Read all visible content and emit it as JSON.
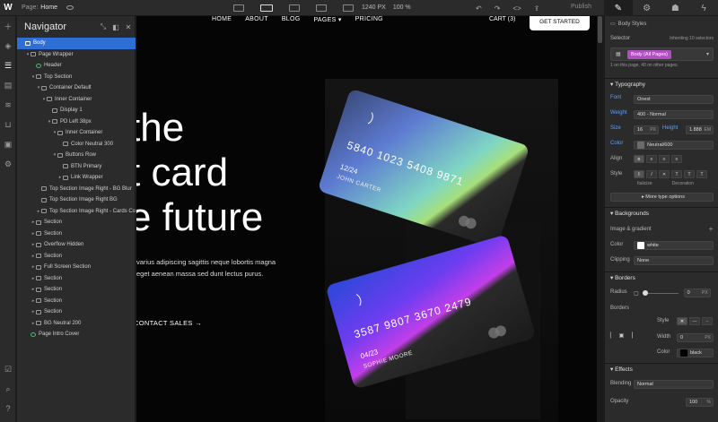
{
  "topbar": {
    "page_label": "Page:",
    "page_name": "Home",
    "width_readout": "1240 PX",
    "zoom_readout": "100 %",
    "publish_label": "Publish",
    "right_tabs": [
      "✎",
      "⚙",
      "☗",
      "ϟ"
    ]
  },
  "navigator": {
    "title": "Navigator",
    "items": [
      {
        "label": "Body",
        "depth": 0,
        "twisty": "",
        "selected": true,
        "icon": "square"
      },
      {
        "label": "Page Wrapper",
        "depth": 1,
        "twisty": "▾",
        "icon": "square"
      },
      {
        "label": "Header",
        "depth": 2,
        "twisty": "",
        "icon": "green"
      },
      {
        "label": "Top Section",
        "depth": 2,
        "twisty": "▾",
        "icon": "square"
      },
      {
        "label": "Container Default",
        "depth": 3,
        "twisty": "▾",
        "icon": "square"
      },
      {
        "label": "Inner Container",
        "depth": 4,
        "twisty": "▾",
        "icon": "square"
      },
      {
        "label": "Display 1",
        "depth": 5,
        "twisty": "",
        "icon": "text"
      },
      {
        "label": "PD Left 38px",
        "depth": 5,
        "twisty": "▾",
        "icon": "square"
      },
      {
        "label": "Inner Container",
        "depth": 6,
        "twisty": "▾",
        "icon": "square"
      },
      {
        "label": "Color Neutral 300",
        "depth": 7,
        "twisty": "",
        "icon": "text"
      },
      {
        "label": "Buttons Row",
        "depth": 6,
        "twisty": "▾",
        "icon": "square"
      },
      {
        "label": "BTN Primary",
        "depth": 7,
        "twisty": "",
        "icon": "link"
      },
      {
        "label": "Link Wrapper",
        "depth": 7,
        "twisty": "▸",
        "icon": "link"
      },
      {
        "label": "Top Section Image Right - BG Blur",
        "depth": 3,
        "twisty": "",
        "icon": "square"
      },
      {
        "label": "Top Section Image Right BG",
        "depth": 3,
        "twisty": "",
        "icon": "image"
      },
      {
        "label": "Top Section Image Right - Cards Co",
        "depth": 3,
        "twisty": "▸",
        "icon": "square"
      },
      {
        "label": "Section",
        "depth": 2,
        "twisty": "▸",
        "icon": "square"
      },
      {
        "label": "Section",
        "depth": 2,
        "twisty": "▸",
        "icon": "square"
      },
      {
        "label": "Overflow Hidden",
        "depth": 2,
        "twisty": "▸",
        "icon": "square"
      },
      {
        "label": "Section",
        "depth": 2,
        "twisty": "▸",
        "icon": "square"
      },
      {
        "label": "Full Screen Section",
        "depth": 2,
        "twisty": "▸",
        "icon": "square"
      },
      {
        "label": "Section",
        "depth": 2,
        "twisty": "▸",
        "icon": "square"
      },
      {
        "label": "Section",
        "depth": 2,
        "twisty": "▸",
        "icon": "square"
      },
      {
        "label": "Section",
        "depth": 2,
        "twisty": "▸",
        "icon": "square"
      },
      {
        "label": "Section",
        "depth": 2,
        "twisty": "▸",
        "icon": "square"
      },
      {
        "label": "BG Neutral 200",
        "depth": 2,
        "twisty": "▸",
        "icon": "square"
      },
      {
        "label": "Page Intro Cover",
        "depth": 1,
        "twisty": "",
        "icon": "green"
      }
    ]
  },
  "canvas": {
    "nav_links": [
      "HOME",
      "ABOUT",
      "BLOG",
      "PAGES ▾",
      "PRICING"
    ],
    "cart": "CART (3)",
    "cta": "GET STARTED",
    "hero_lines": [
      "the",
      "t card",
      "e future"
    ],
    "paragraph": "varius adipiscing sagittis neque lobortis magna eget aenean massa sed dunt lectus purus.",
    "secondary_cta": "CONTACT SALES →",
    "card1": {
      "number": "5840 1023 5408 9871",
      "expiry": "12/24",
      "name": "JOHN CARTER"
    },
    "card2": {
      "number": "3587 9807 3670 2479",
      "expiry": "04/23",
      "name": "SOPHIE MOORE"
    }
  },
  "panel": {
    "header": "Body Styles",
    "selector_label": "Selector",
    "inheriting": "Inheriting 10 selectors",
    "selector_chip": "Body (All Pages)",
    "usage_note": "1 on this page, 40 on other pages.",
    "typography": {
      "title": "Typography",
      "font_label": "Font",
      "font_value": "Onest",
      "weight_label": "Weight",
      "weight_value": "400 - Normal",
      "size_label": "Size",
      "size_value": "16",
      "size_unit": "PX",
      "height_label": "Height",
      "height_value": "1.888",
      "height_unit": "EM",
      "color_label": "Color",
      "color_value": "Neutral/600",
      "align_label": "Align",
      "style_label": "Style",
      "italicize": "Italicize",
      "decoration": "Decoration",
      "more": "▸ More type options"
    },
    "backgrounds": {
      "title": "Backgrounds",
      "image_gradient": "Image & gradient",
      "color_label": "Color",
      "color_value": "white",
      "clipping_label": "Clipping",
      "clipping_value": "None"
    },
    "borders": {
      "title": "Borders",
      "radius_label": "Radius",
      "radius_value": "0",
      "radius_unit": "PX",
      "borders_label": "Borders",
      "style_label": "Style",
      "width_label": "Width",
      "width_value": "0",
      "width_unit": "PX",
      "color_label": "Color",
      "color_value": "black"
    },
    "effects": {
      "title": "Effects",
      "blending_label": "Blending",
      "blending_value": "Normal",
      "opacity_label": "Opacity",
      "opacity_value": "100",
      "opacity_unit": "%"
    }
  },
  "colors": {
    "accent": "#2e6fd6",
    "chip": "#b04ec2"
  }
}
